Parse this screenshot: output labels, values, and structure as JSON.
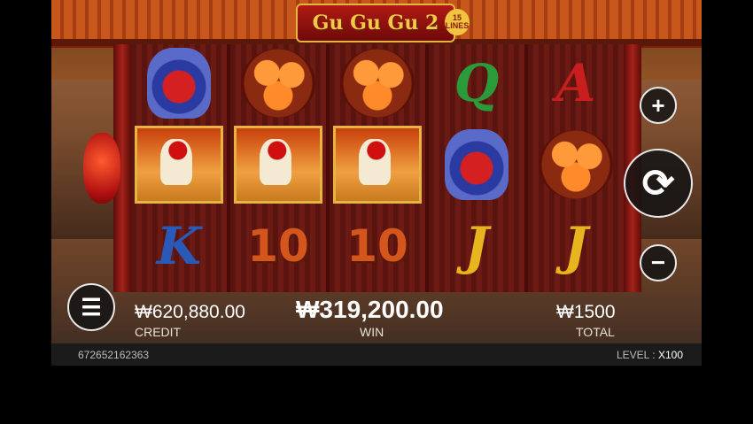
{
  "game": {
    "title": "Gu Gu Gu 2",
    "lines_badge": {
      "count": "15",
      "word": "LINES"
    }
  },
  "reels": [
    [
      "vase-symbol",
      "rooster-symbol",
      "K"
    ],
    [
      "persimmon-symbol",
      "rooster-symbol",
      "10"
    ],
    [
      "persimmon-symbol",
      "rooster-symbol",
      "10"
    ],
    [
      "Q",
      "vase-symbol",
      "J"
    ],
    [
      "A",
      "persimmon-symbol",
      "J"
    ]
  ],
  "symbol_colors": {
    "Q": "#2a9a3a",
    "A": "#c81e1e",
    "K": "#2a5ab8",
    "J": "#e8b420",
    "10": "#d4561c"
  },
  "hud": {
    "credit_value": "₩620,880.00",
    "credit_label": "CREDIT",
    "win_value": "₩319,200.00",
    "win_label": "WIN",
    "total_value": "₩1500",
    "total_label": "TOTAL"
  },
  "controls": {
    "plus_icon": "plus-icon",
    "spin_icon": "refresh-icon",
    "minus_icon": "minus-icon",
    "menu_icon": "hamburger-menu-icon"
  },
  "footer": {
    "id_text": "672652162363",
    "level_label": "LEVEL :",
    "level_value": "X100"
  }
}
